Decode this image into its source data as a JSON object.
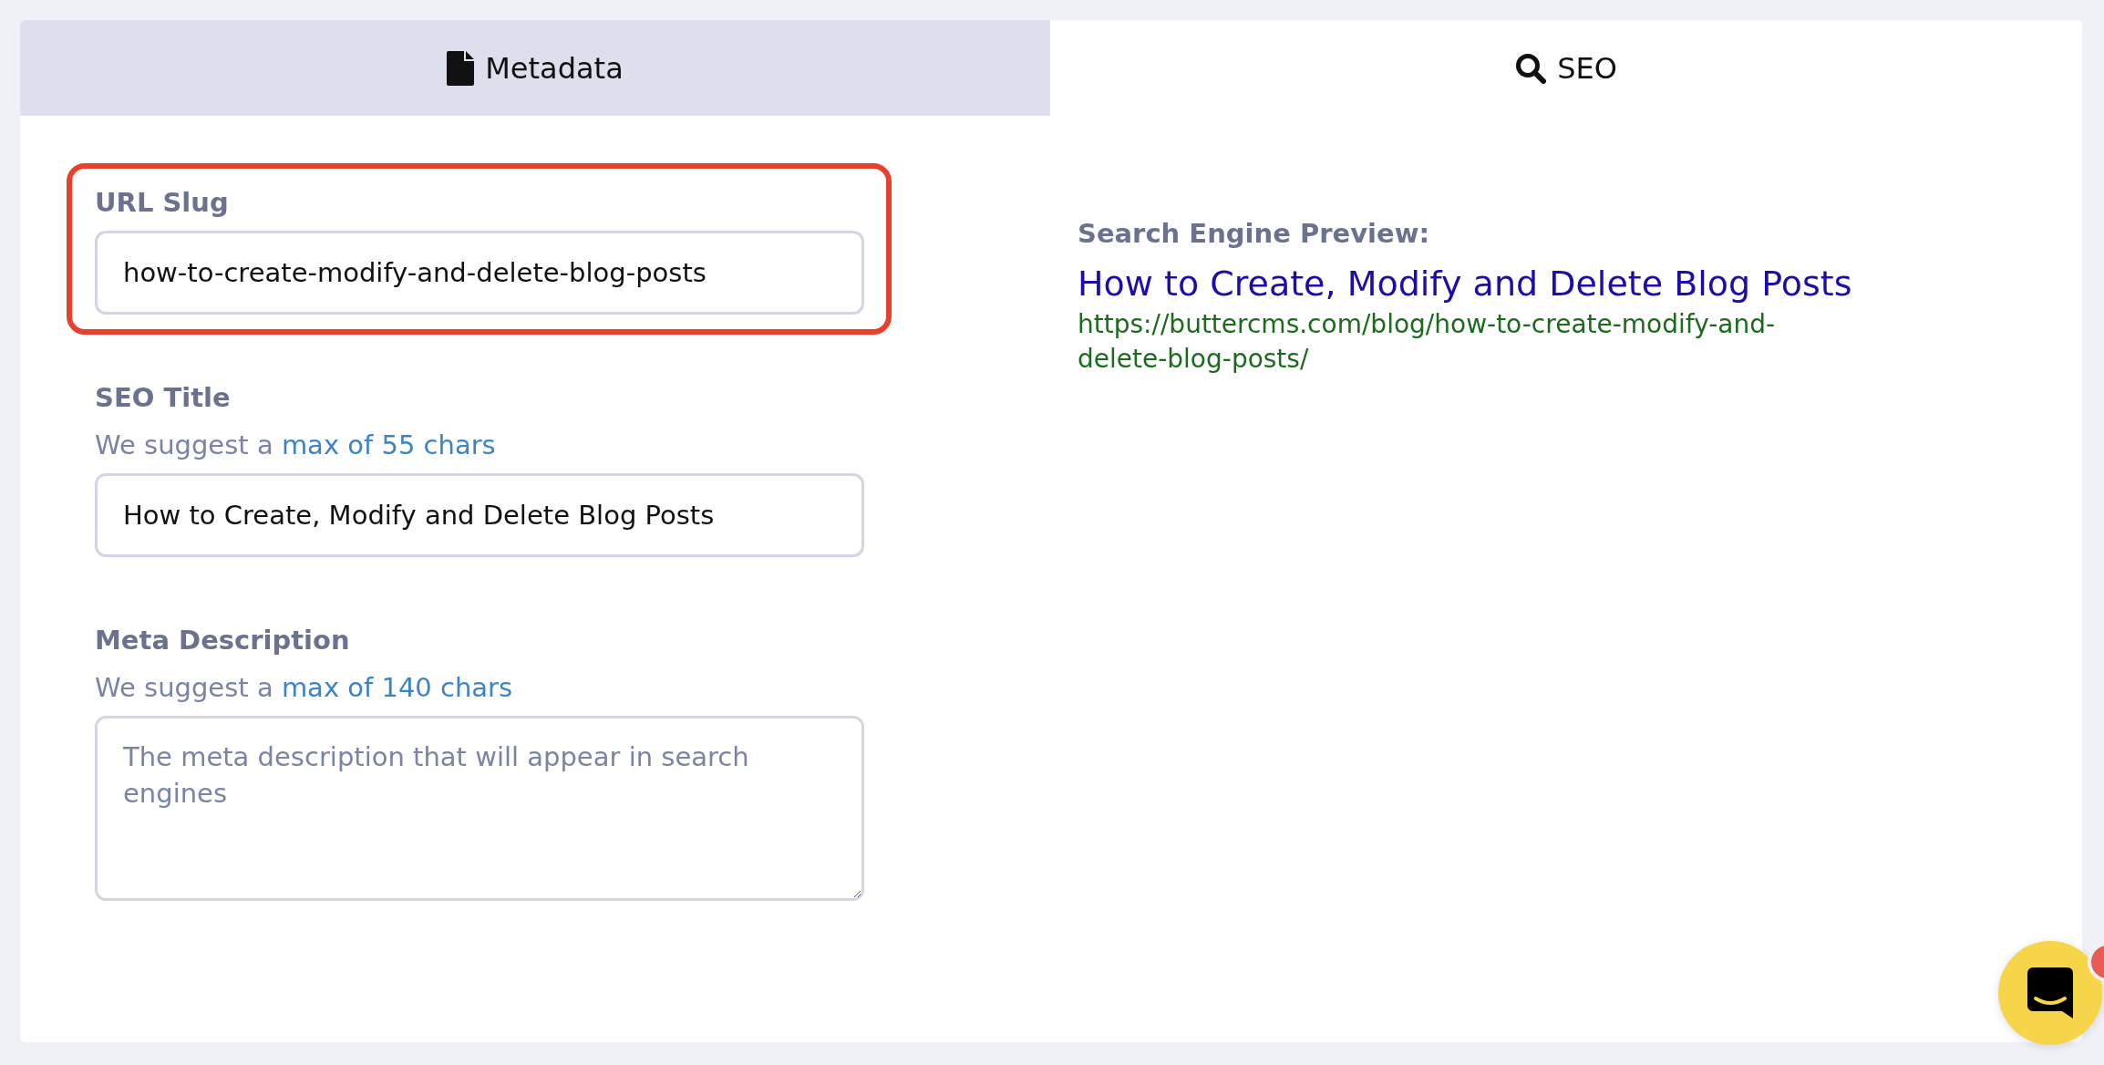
{
  "tabs": [
    {
      "label": "Metadata",
      "kind": "document",
      "selected": false
    },
    {
      "label": "SEO",
      "kind": "search",
      "selected": true
    }
  ],
  "fields": [
    {
      "label": "URL Slug",
      "kind": "input",
      "value": "how-to-create-modify-and-delete-blog-posts",
      "highlighted": true
    },
    {
      "label": "SEO Title",
      "kind": "input",
      "hint": "We suggest a",
      "hint_link": "max of 55 chars",
      "value": "How to Create, Modify and Delete Blog Posts",
      "highlighted": false
    },
    {
      "label": "Meta Description",
      "kind": "textarea",
      "hint": "We suggest a",
      "hint_link": "max of 140 chars",
      "placeholder": "The meta description that will appear in search engines",
      "highlighted": false
    }
  ],
  "preview": {
    "heading": "Search Engine Preview:",
    "title": "How to Create, Modify and Delete Blog Posts",
    "url": "https://buttercms.com/blog/how-to-create-modify-and-delete-blog-posts/"
  },
  "chat": {
    "unread": true
  }
}
